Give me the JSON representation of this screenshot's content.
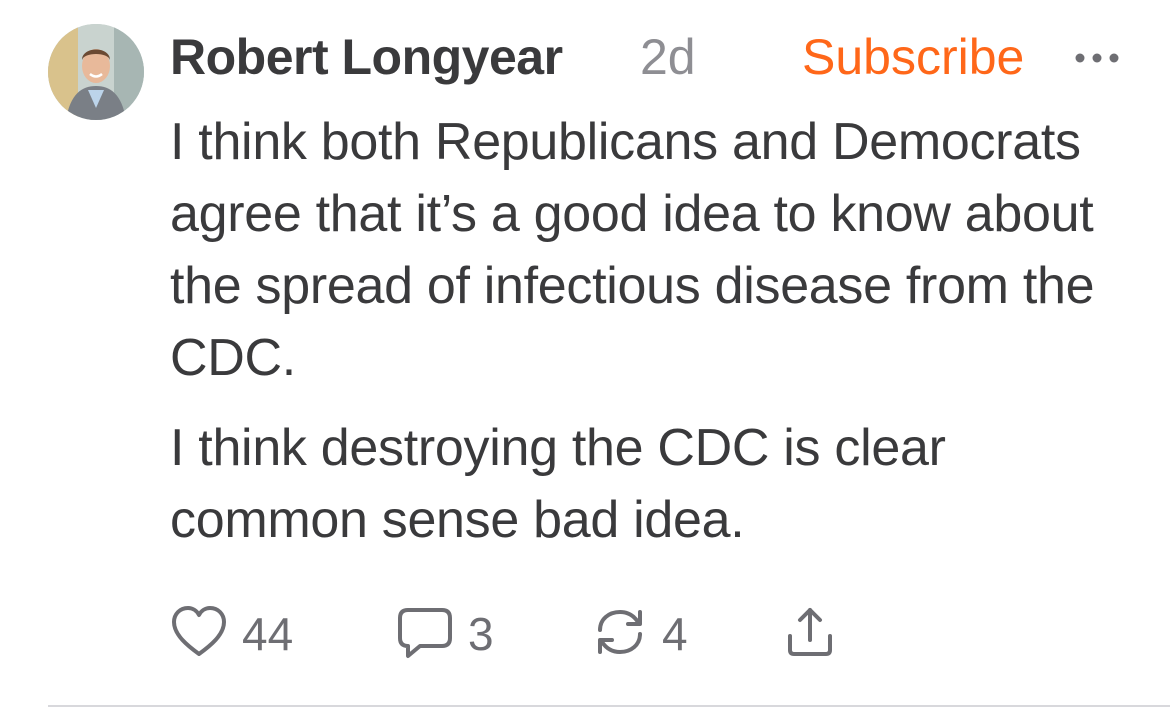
{
  "post": {
    "author": "Robert Longyear",
    "time_ago": "2d",
    "subscribe_label": "Subscribe",
    "paragraphs": [
      "I think both Republicans and Democrats agree that it’s a good idea to know about the spread of infectious disease from the CDC.",
      "I think destroying the CDC is clear common sense bad idea."
    ]
  },
  "actions": {
    "likes": "44",
    "comments": "3",
    "restacks": "4"
  },
  "icons": {
    "like": "heart-icon",
    "comment": "comment-bubble-icon",
    "restack": "restack-arrows-icon",
    "share": "share-icon",
    "more": "more-horizontal-icon"
  },
  "colors": {
    "accent": "#ff6719",
    "text": "#3a3a3c",
    "muted": "#8e8e93",
    "icon": "#6e6e73"
  }
}
